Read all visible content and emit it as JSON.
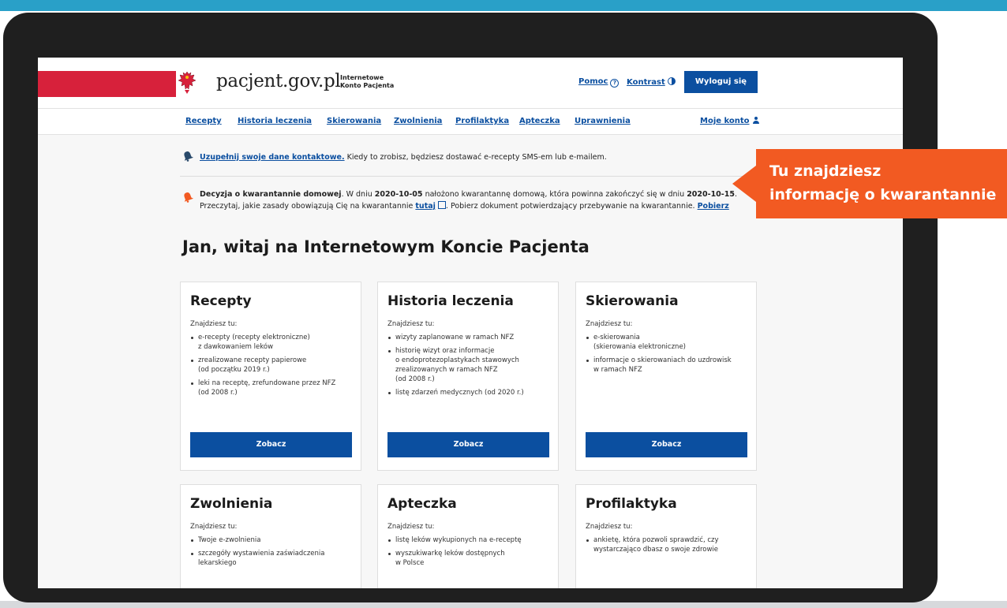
{
  "header": {
    "logo": "pacjent.gov.pl",
    "subtitle_line1": "Internetowe",
    "subtitle_line2": "Konto Pacjenta",
    "help": "Pomoc",
    "contrast": "Kontrast",
    "logout": "Wyloguj się"
  },
  "nav": {
    "items": [
      "Recepty",
      "Historia leczenia",
      "Skierowania",
      "Zwolnienia",
      "Profilaktyka",
      "Apteczka",
      "Uprawnienia"
    ],
    "account": "Moje konto"
  },
  "notices": {
    "contact_link": "Uzupełnij swoje dane kontaktowe.",
    "contact_text": " Kiedy to zrobisz, będziesz dostawać e-recepty SMS-em lub e-mailem.",
    "q_title": "Decyzja o kwarantannie domowej",
    "q_t1": ". W dniu ",
    "q_date1": "2020-10-05",
    "q_t2": " nałożono kwarantannę domową, która powinna zakończyć się w dniu ",
    "q_date2": "2020-10-15",
    "q_t3": ".",
    "q_t4": "Przeczytaj, jakie zasady obowiązują Cię na kwarantannie ",
    "q_here": "tutaj",
    "q_t5": ". Pobierz dokument potwierdzający przebywanie na kwarantannie. ",
    "q_download": "Pobierz"
  },
  "welcome": "Jan, witaj na Internetowym Koncie Pacjenta",
  "cards": [
    {
      "title": "Recepty",
      "intro": "Znajdziesz tu:",
      "items": [
        "e-recepty (recepty elektroniczne)\nz dawkowaniem leków",
        "zrealizowane recepty papierowe\n(od początku 2019 r.)",
        "leki na receptę, zrefundowane przez NFZ\n(od 2008 r.)"
      ],
      "button": "Zobacz"
    },
    {
      "title": "Historia leczenia",
      "intro": "Znajdziesz tu:",
      "items": [
        "wizyty zaplanowane w ramach NFZ",
        "historię wizyt oraz informacje\no endoprotezoplastykach stawowych\nzrealizowanych w ramach NFZ\n(od 2008 r.)",
        "listę zdarzeń medycznych (od 2020 r.)"
      ],
      "button": "Zobacz"
    },
    {
      "title": "Skierowania",
      "intro": "Znajdziesz tu:",
      "items": [
        "e-skierowania\n(skierowania elektroniczne)",
        "informacje o skierowaniach do uzdrowisk\nw ramach NFZ"
      ],
      "button": "Zobacz"
    },
    {
      "title": "Zwolnienia",
      "intro": "Znajdziesz tu:",
      "items": [
        "Twoje e-zwolnienia",
        "szczegóły wystawienia zaświadczenia\nlekarskiego"
      ]
    },
    {
      "title": "Apteczka",
      "intro": "Znajdziesz tu:",
      "items": [
        "listę leków wykupionych na e-receptę",
        "wyszukiwarkę leków dostępnych\nw Polsce"
      ]
    },
    {
      "title": "Profilaktyka",
      "intro": "Znajdziesz tu:",
      "items": [
        "ankietę, która pozwoli sprawdzić, czy\nwystarczająco dbasz o swoje zdrowie"
      ]
    }
  ],
  "callout": {
    "line1": "Tu znajdziesz",
    "line2": "informację o kwarantannie"
  },
  "colors": {
    "primary": "#0b4fa0",
    "flag_red": "#d7213b",
    "callout": "#f25a22",
    "top_bar": "#29a0c8"
  }
}
